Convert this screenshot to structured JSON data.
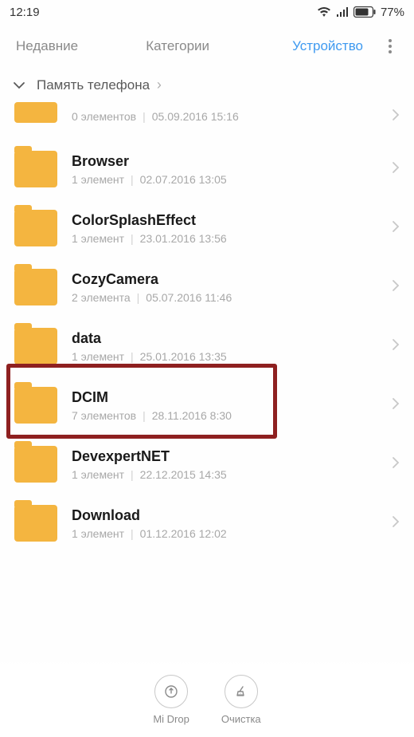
{
  "status": {
    "time": "12:19",
    "battery": "77%"
  },
  "tabs": {
    "recent": "Недавние",
    "categories": "Категории",
    "device": "Устройство"
  },
  "breadcrumb": {
    "label": "Память телефона"
  },
  "folders": [
    {
      "name": "",
      "count": "0 элементов",
      "date": "05.09.2016 15:16",
      "partial": "top"
    },
    {
      "name": "Browser",
      "count": "1 элемент",
      "date": "02.07.2016 13:05"
    },
    {
      "name": "ColorSplashEffect",
      "count": "1 элемент",
      "date": "23.01.2016 13:56"
    },
    {
      "name": "CozyCamera",
      "count": "2 элемента",
      "date": "05.07.2016 11:46"
    },
    {
      "name": "data",
      "count": "1 элемент",
      "date": "25.01.2016 13:35",
      "highlight": true
    },
    {
      "name": "DCIM",
      "count": "7 элементов",
      "date": "28.11.2016 8:30"
    },
    {
      "name": "DevexpertNET",
      "count": "1 элемент",
      "date": "22.12.2015 14:35"
    },
    {
      "name": "Download",
      "count": "1 элемент",
      "date": "01.12.2016 12:02"
    }
  ],
  "bottom": {
    "midrop": "Mi Drop",
    "clean": "Очистка"
  }
}
